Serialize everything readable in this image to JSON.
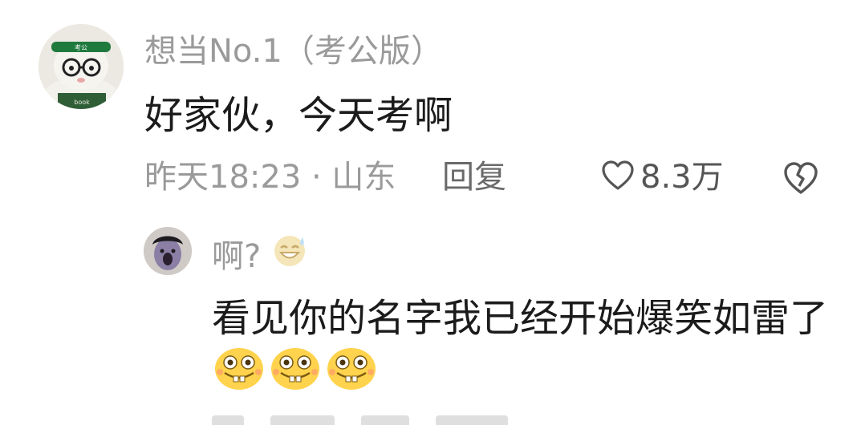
{
  "comment": {
    "username": "想当No.1（考公版）",
    "text": "好家伙，今天考啊",
    "meta": "昨天18:23 · 山东",
    "reply_label": "回复",
    "like_count": "8.3万",
    "avatar_text": "考公",
    "avatar_badge_text": "book"
  },
  "reply": {
    "username": "啊?",
    "username_emoji": "sweat-smile-emoji",
    "text": "看见你的名字我已经开始爆笑如雷了",
    "emojis": [
      "grin-emoji",
      "grin-emoji",
      "grin-emoji"
    ]
  },
  "colors": {
    "muted": "#9a9a9a",
    "text": "#1b1b1b",
    "emoji_yellow": "#ffd34d"
  }
}
